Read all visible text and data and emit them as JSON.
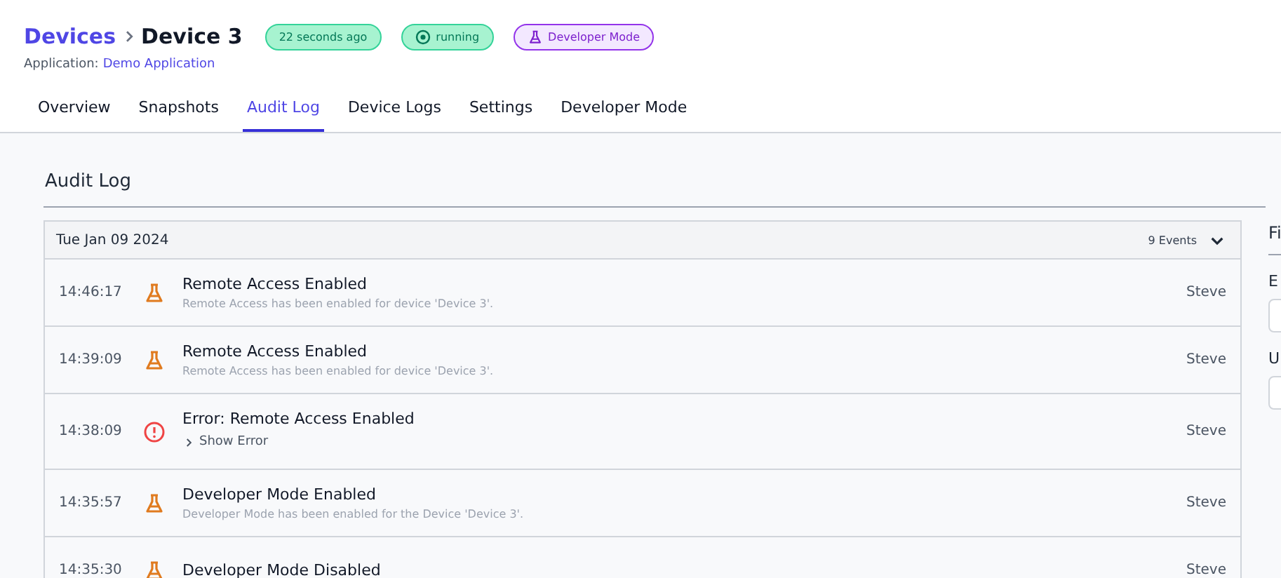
{
  "breadcrumb": {
    "parent": "Devices",
    "current": "Device 3"
  },
  "badges": [
    {
      "kind": "time",
      "label": "22 seconds ago"
    },
    {
      "kind": "status",
      "label": "running"
    },
    {
      "kind": "devmode",
      "label": "Developer Mode"
    }
  ],
  "application": {
    "label": "Application:",
    "link": "Demo Application"
  },
  "tabs": [
    {
      "label": "Overview",
      "selected": false
    },
    {
      "label": "Snapshots",
      "selected": false
    },
    {
      "label": "Audit Log",
      "selected": true
    },
    {
      "label": "Device Logs",
      "selected": false
    },
    {
      "label": "Settings",
      "selected": false
    },
    {
      "label": "Developer Mode",
      "selected": false
    }
  ],
  "section_title": "Audit Log",
  "log_group": {
    "date": "Tue Jan 09 2024",
    "count": "9 Events",
    "expanded": true,
    "entries": [
      {
        "time": "14:46:17",
        "kind": "event",
        "title": "Remote Access Enabled",
        "detail": "Remote Access has been enabled for device 'Device 3'.",
        "user": "Steve"
      },
      {
        "time": "14:39:09",
        "kind": "event",
        "title": "Remote Access Enabled",
        "detail": "Remote Access has been enabled for device 'Device 3'.",
        "user": "Steve"
      },
      {
        "time": "14:38:09",
        "kind": "error",
        "title": "Error: Remote Access Enabled",
        "detail": "Show Error",
        "user": "Steve"
      },
      {
        "time": "14:35:57",
        "kind": "event",
        "title": "Developer Mode Enabled",
        "detail": "Developer Mode has been enabled for the Device 'Device 3'.",
        "user": "Steve"
      },
      {
        "time": "14:35:30",
        "kind": "event",
        "title": "Developer Mode Disabled",
        "user": "Steve"
      }
    ]
  },
  "filters": {
    "title": "Fi",
    "fields": [
      {
        "label": "E"
      },
      {
        "label": "U"
      }
    ]
  }
}
